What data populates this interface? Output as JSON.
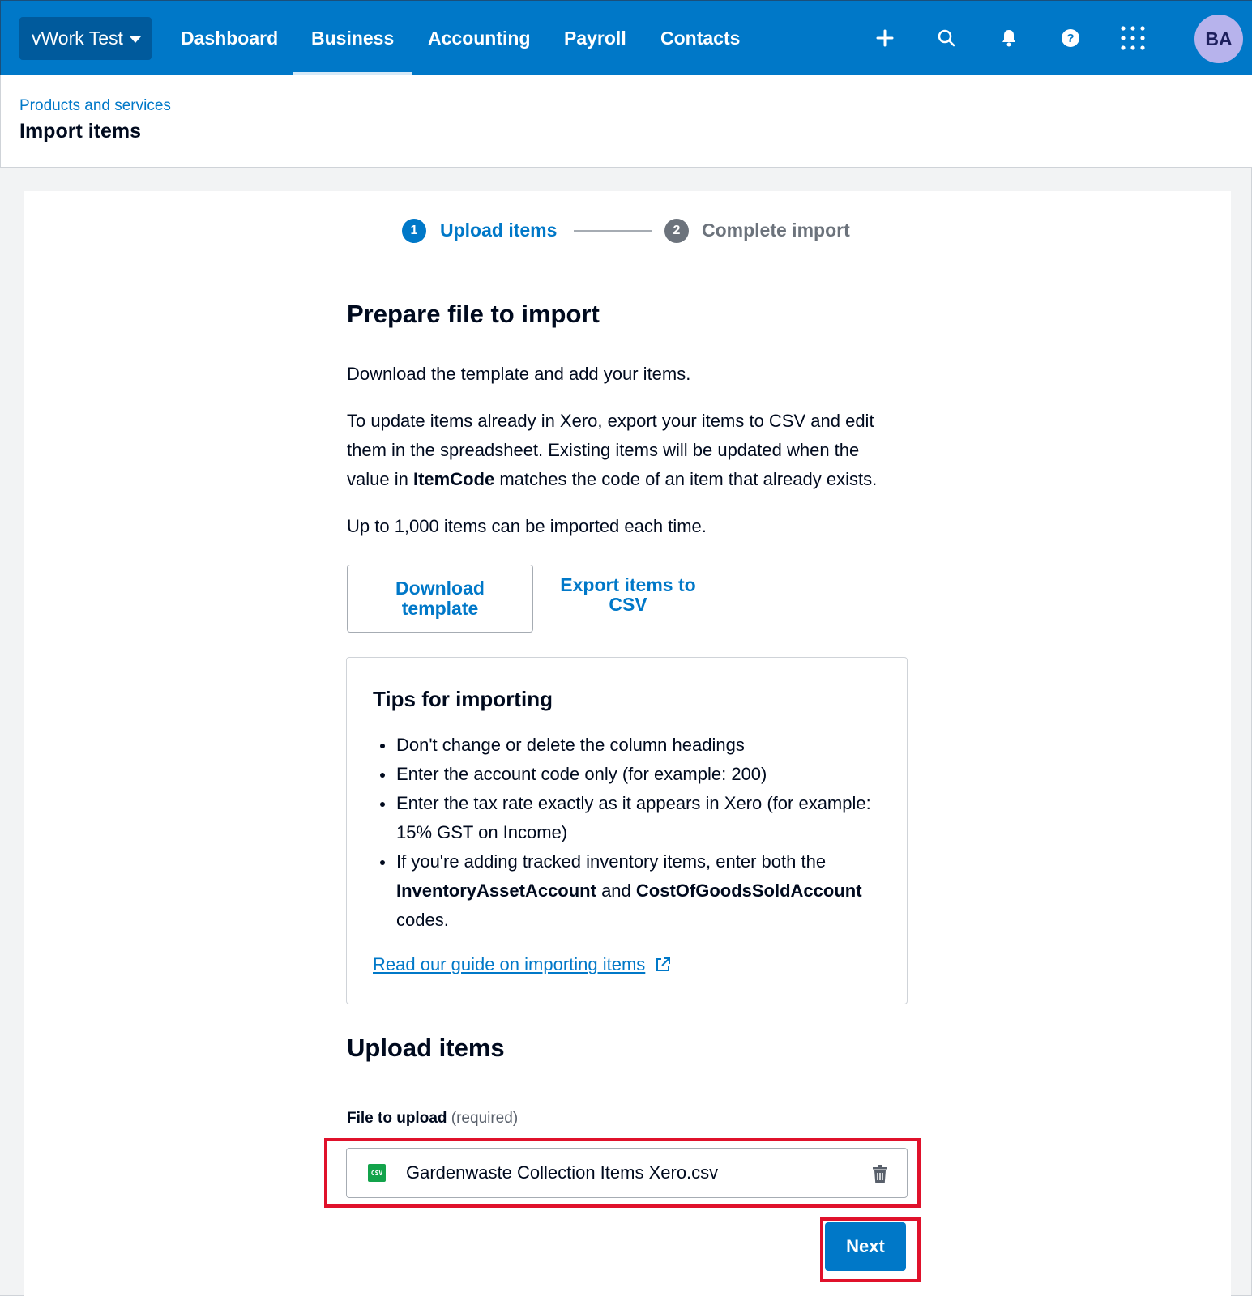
{
  "nav": {
    "org_name": "vWork Test",
    "items": [
      {
        "label": "Dashboard",
        "active": false
      },
      {
        "label": "Business",
        "active": true
      },
      {
        "label": "Accounting",
        "active": false
      },
      {
        "label": "Payroll",
        "active": false
      },
      {
        "label": "Contacts",
        "active": false
      }
    ],
    "icons": [
      "plus-icon",
      "search-icon",
      "bell-icon",
      "help-icon",
      "apps-grid-icon"
    ],
    "avatar_initials": "BA"
  },
  "header": {
    "breadcrumb": "Products and services",
    "title": "Import items"
  },
  "stepper": {
    "steps": [
      {
        "number": "1",
        "label": "Upload items",
        "active": true
      },
      {
        "number": "2",
        "label": "Complete import",
        "active": false
      }
    ]
  },
  "prepare": {
    "heading": "Prepare file to import",
    "intro": "Download the template and add your items.",
    "update_text_1": "To update items already in Xero, export your items to CSV and edit them in the spreadsheet. Existing items will be updated when the value in ",
    "update_text_bold": "ItemCode",
    "update_text_2": " matches the code of an item that already exists.",
    "limit_text": "Up to 1,000 items can be imported each time.",
    "download_label": "Download template",
    "export_label": "Export items to CSV"
  },
  "tips": {
    "title": "Tips for importing",
    "items": [
      "Don't change or delete the column headings",
      "Enter the account code only (for example: 200)",
      "Enter the tax rate exactly as it appears in Xero (for example: 15% GST on Income)"
    ],
    "tracked_prefix": "If you're adding tracked inventory items, enter both the ",
    "tracked_bold_1": "InventoryAssetAccount",
    "tracked_and": " and ",
    "tracked_bold_2": "CostOfGoodsSoldAccount",
    "tracked_suffix": " codes.",
    "guide_link": "Read our guide on importing items"
  },
  "upload": {
    "heading": "Upload items",
    "field_label": "File to upload",
    "required_text": "(required)",
    "file_badge": "CSV",
    "file_name": "Gardenwaste Collection Items Xero.csv",
    "next_label": "Next"
  },
  "colors": {
    "brand_blue": "#0078c8",
    "highlight_red": "#e0112b",
    "csv_green": "#13a34b"
  }
}
